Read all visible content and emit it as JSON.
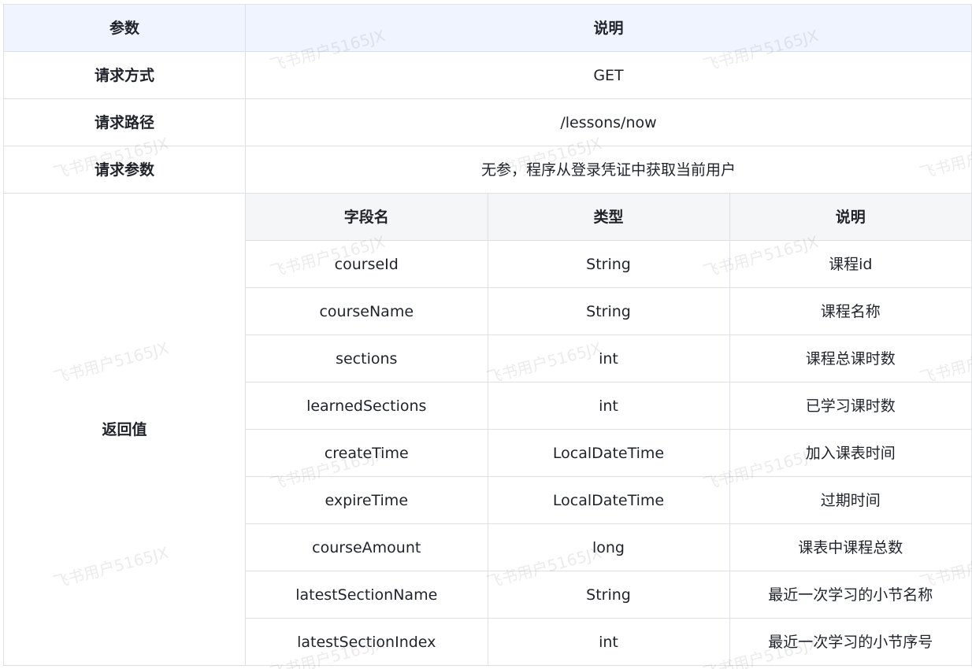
{
  "header": {
    "param": "参数",
    "desc": "说明"
  },
  "rows": {
    "method_label": "请求方式",
    "method_value": "GET",
    "path_label": "请求路径",
    "path_value": "/lessons/now",
    "params_label": "请求参数",
    "params_value": "无参，程序从登录凭证中获取当前用户",
    "return_label": "返回值"
  },
  "return_table": {
    "columns": [
      "字段名",
      "类型",
      "说明"
    ],
    "fields": [
      {
        "name": "courseId",
        "type": "String",
        "desc": "课程id"
      },
      {
        "name": "courseName",
        "type": "String",
        "desc": "课程名称"
      },
      {
        "name": "sections",
        "type": "int",
        "desc": "课程总课时数"
      },
      {
        "name": "learnedSections",
        "type": "int",
        "desc": "已学习课时数"
      },
      {
        "name": "createTime",
        "type": "LocalDateTime",
        "desc": "加入课表时间"
      },
      {
        "name": "expireTime",
        "type": "LocalDateTime",
        "desc": "过期时间"
      },
      {
        "name": "courseAmount",
        "type": "long",
        "desc": "课表中课程总数"
      },
      {
        "name": "latestSectionName",
        "type": "String",
        "desc": "最近一次学习的小节名称"
      },
      {
        "name": "latestSectionIndex",
        "type": "int",
        "desc": "最近一次学习的小节序号"
      }
    ]
  },
  "watermark": "飞书用户5165JX"
}
